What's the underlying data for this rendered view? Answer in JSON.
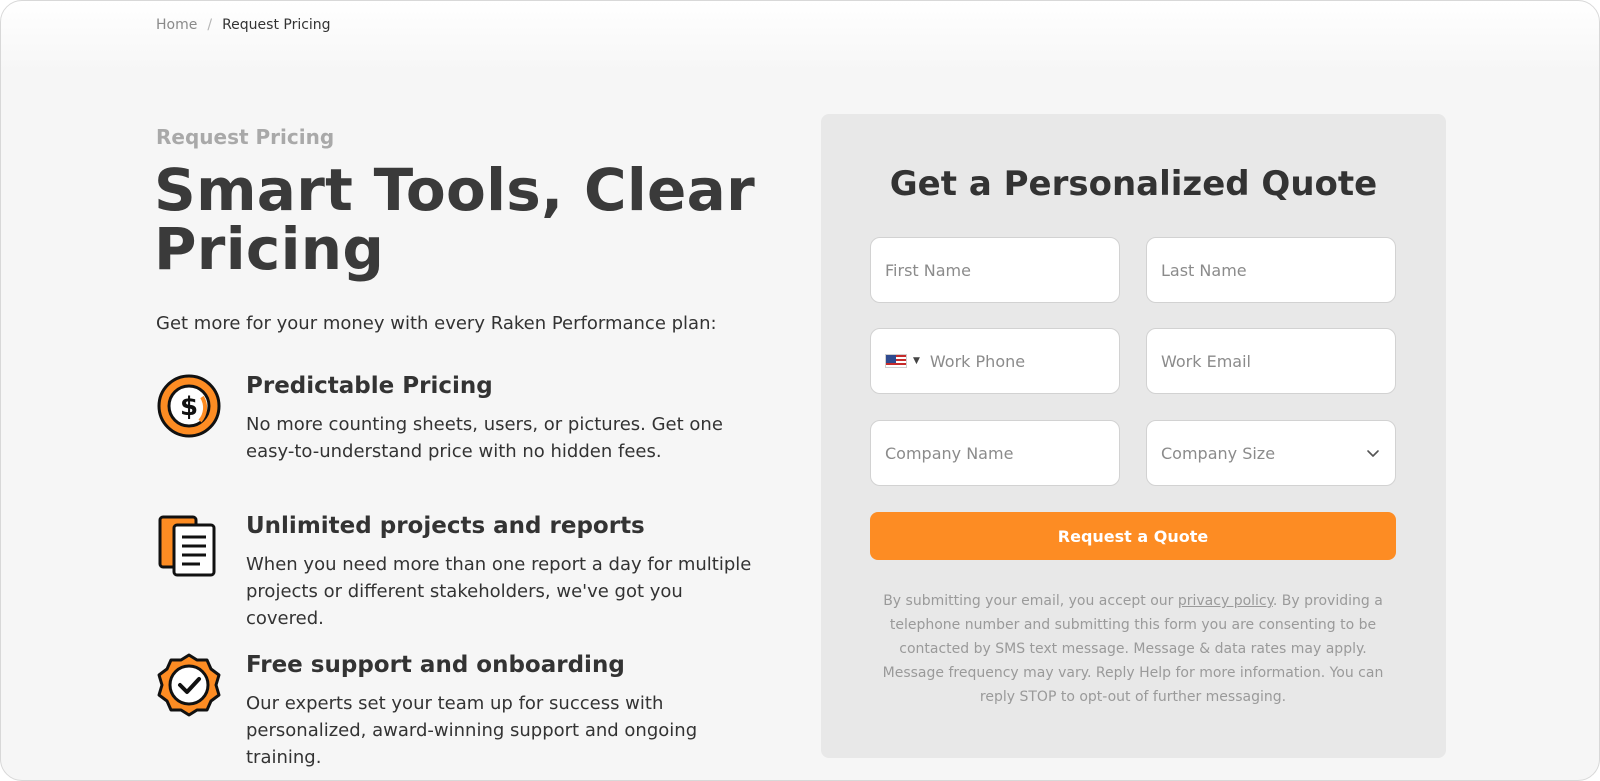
{
  "breadcrumb": {
    "home": "Home",
    "separator": "/",
    "current": "Request Pricing"
  },
  "hero": {
    "eyebrow": "Request Pricing",
    "headline_line1": "Smart Tools, Clear",
    "headline_line2": "Pricing",
    "intro": "Get more for your money with every Raken Performance plan:"
  },
  "features": [
    {
      "icon": "dollar-coin-icon",
      "title": "Predictable Pricing",
      "text": "No more counting sheets, users, or pictures. Get one easy-to-understand price with no hidden fees."
    },
    {
      "icon": "documents-icon",
      "title": "Unlimited projects and reports",
      "text": "When you need more than one report a day for multiple projects or different stakeholders, we've got you covered."
    },
    {
      "icon": "badge-check-icon",
      "title": "Free support and onboarding",
      "text": "Our experts set your team up for success with personalized, award-winning support and ongoing training."
    }
  ],
  "form": {
    "title": "Get a Personalized Quote",
    "first_name": "First Name",
    "last_name": "Last Name",
    "work_phone": "Work Phone",
    "work_email": "Work Email",
    "company_name": "Company Name",
    "company_size": "Company Size",
    "submit_label": "Request a Quote",
    "disclaimer_before": "By submitting your email, you accept our ",
    "privacy_link": "privacy policy",
    "disclaimer_after": ". By providing a telephone number and submitting this form you are consenting to be contacted by SMS text message. Message & data rates may apply. Message frequency may vary. Reply Help for more information. You can reply STOP to opt-out of further messaging."
  },
  "colors": {
    "accent": "#fd8c23",
    "heading": "#3a3a3a",
    "panel": "#e8e8e8"
  }
}
